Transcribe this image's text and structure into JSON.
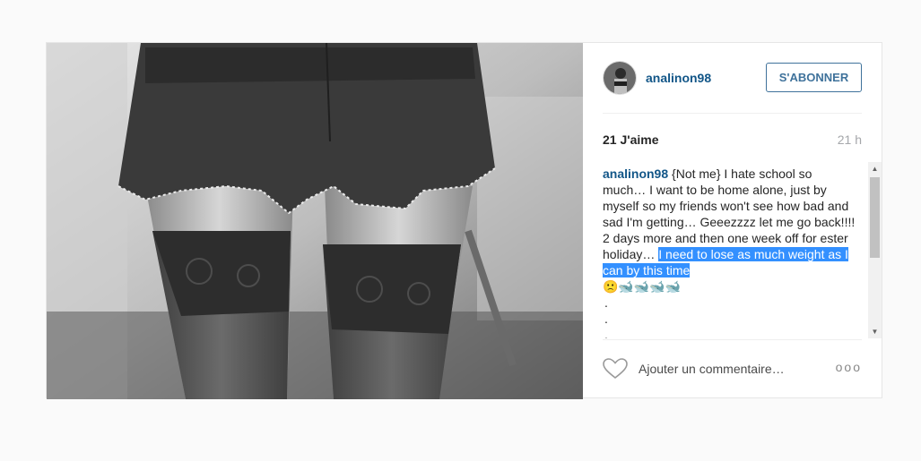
{
  "post": {
    "author": "analinon98",
    "follow_label": "S'ABONNER",
    "likes": "21 J'aime",
    "time_ago": "21 h",
    "caption": {
      "author": "analinon98",
      "text": " {Not me} I hate school so much… I want to be home alone, just by myself so my friends won't see how bad and sad I'm getting… Geeezzzz let me go back!!!! 2 days more and then one week off for ester holiday… ",
      "highlighted": "I need to lose as much weight as I can by this time",
      "emojis": "🙁🐋🐋🐋🐋",
      "dots": [
        ".",
        ".",
        "."
      ]
    },
    "comment_placeholder": "Ajouter un commentaire…",
    "more_label": "ooo",
    "photo_description_icon": "photo",
    "avatar_icon": "avatar",
    "like_icon": "heart-icon"
  },
  "colors": {
    "username": "#125688",
    "follow_border": "#3f729b",
    "selection": "#3390ff",
    "page_bg": "#fafafa"
  }
}
